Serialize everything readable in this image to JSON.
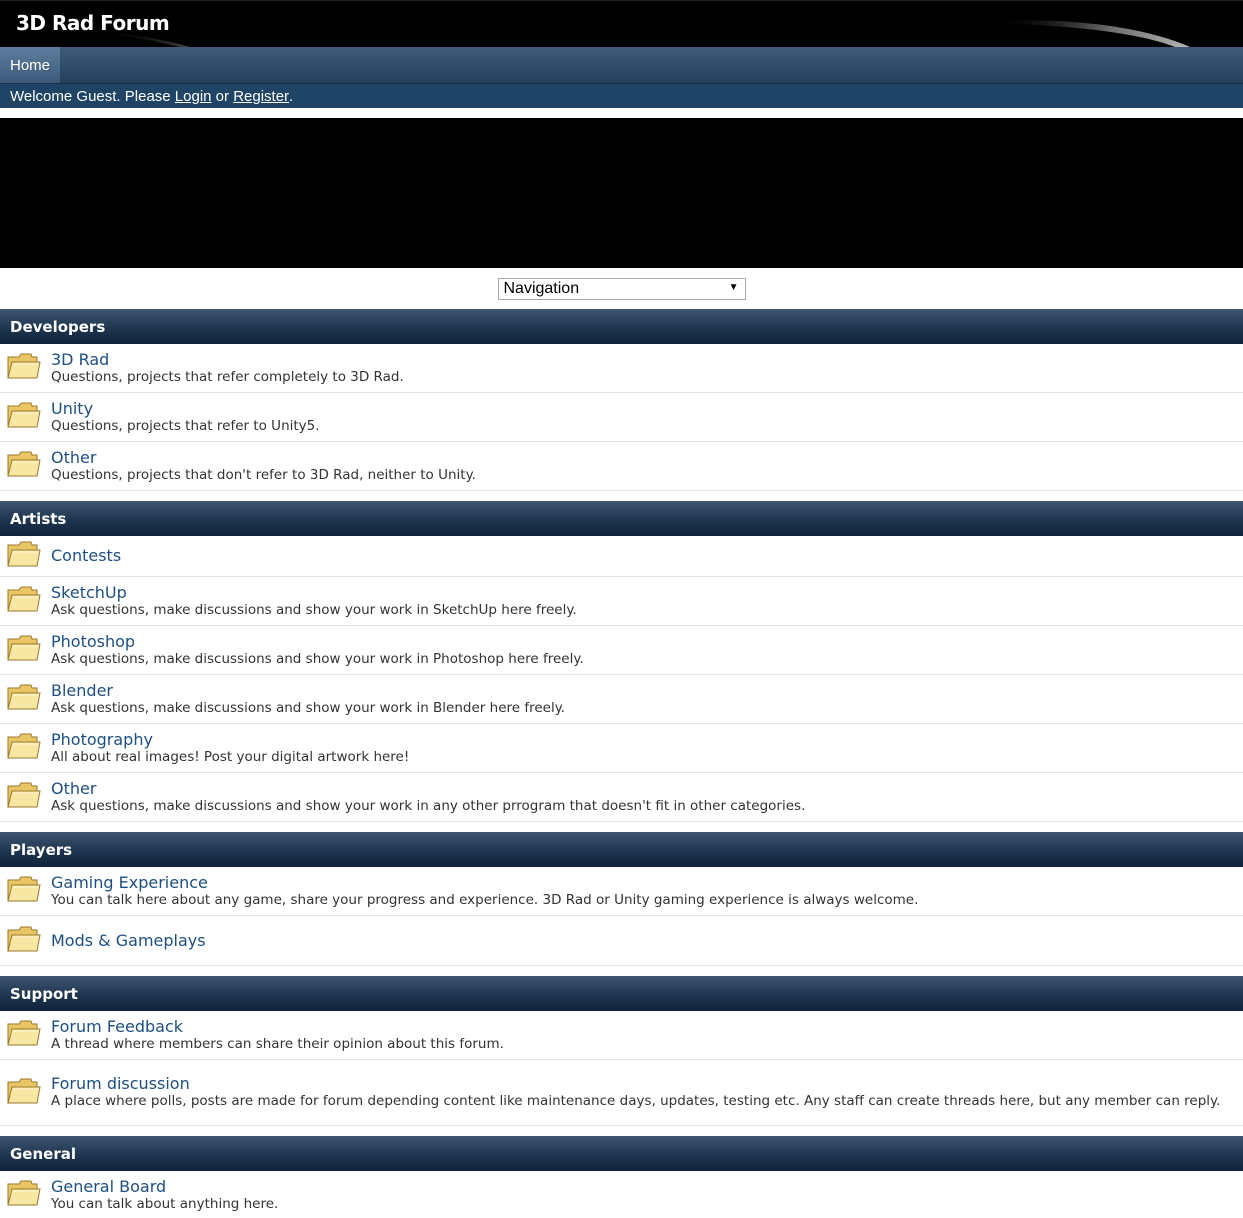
{
  "site": {
    "title": "3D Rad Forum"
  },
  "nav": {
    "home_label": "Home"
  },
  "welcome": {
    "prefix": "Welcome Guest. Please ",
    "login": "Login",
    "middle": " or ",
    "register": "Register",
    "suffix": "."
  },
  "navigation_select": {
    "selected": "Navigation"
  },
  "categories": [
    {
      "name": "Developers",
      "forums": [
        {
          "title": "3D Rad",
          "desc": "Questions, projects that refer completely to 3D Rad."
        },
        {
          "title": "Unity",
          "desc": "Questions, projects that refer to Unity5."
        },
        {
          "title": "Other",
          "desc": "Questions, projects that don't refer to 3D Rad, neither to Unity."
        }
      ]
    },
    {
      "name": "Artists",
      "forums": [
        {
          "title": "Contests",
          "desc": ""
        },
        {
          "title": "SketchUp",
          "desc": "Ask questions, make discussions and show your work in SketchUp here freely."
        },
        {
          "title": "Photoshop",
          "desc": "Ask questions, make discussions and show your work in Photoshop here freely."
        },
        {
          "title": "Blender",
          "desc": "Ask questions, make discussions and show your work in Blender here freely."
        },
        {
          "title": "Photography",
          "desc": "All about real images! Post your digital artwork here!"
        },
        {
          "title": "Other",
          "desc": "Ask questions, make discussions and show your work in any other prrogram that doesn't fit in other categories."
        }
      ]
    },
    {
      "name": "Players",
      "forums": [
        {
          "title": "Gaming Experience",
          "desc": "You can talk here about any game, share your progress and experience. 3D Rad or Unity gaming experience is always welcome."
        },
        {
          "title": "Mods & Gameplays",
          "desc": ""
        }
      ]
    },
    {
      "name": "Support",
      "forums": [
        {
          "title": "Forum Feedback",
          "desc": "A thread where members can share their opinion about this forum."
        },
        {
          "title": "Forum discussion",
          "desc": "A place where polls, posts are made for forum depending content like maintenance days, updates, testing etc. Any staff can create threads here, but any member can reply."
        }
      ]
    },
    {
      "name": "General",
      "forums": [
        {
          "title": "General Board",
          "desc": "You can talk about anything here."
        }
      ]
    }
  ]
}
